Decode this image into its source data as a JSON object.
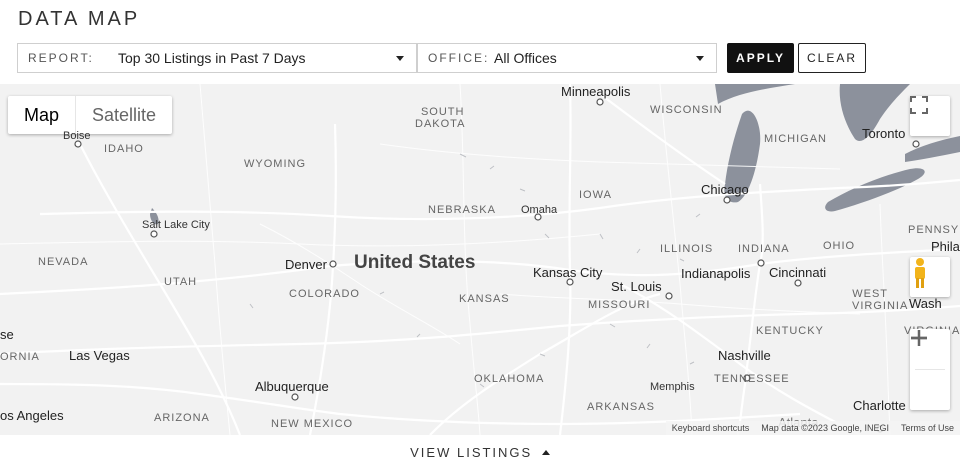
{
  "header": {
    "title": "DATA MAP"
  },
  "filters": {
    "report_label": "REPORT:",
    "report_value": "Top 30 Listings in Past 7 Days",
    "office_label": "OFFICE:",
    "office_value": "All Offices"
  },
  "buttons": {
    "apply": "APPLY",
    "clear": "CLEAR"
  },
  "map": {
    "type_map": "Map",
    "type_satellite": "Satellite",
    "country": "United States",
    "states": {
      "south_dakota_1": "SOUTH",
      "south_dakota_2": "DAKOTA",
      "wisconsin": "WISCONSIN",
      "michigan": "MICHIGAN",
      "idaho": "IDAHO",
      "wyoming": "WYOMING",
      "iowa": "IOWA",
      "nebraska": "NEBRASKA",
      "nevada": "NEVADA",
      "utah": "UTAH",
      "colorado": "COLORADO",
      "kansas": "KANSAS",
      "illinois": "ILLINOIS",
      "indiana": "INDIANA",
      "ohio": "OHIO",
      "pennsylvania": "PENNSYL",
      "missouri": "MISSOURI",
      "west_virginia_1": "WEST",
      "west_virginia_2": "VIRGINIA",
      "kentucky": "KENTUCKY",
      "virginia": "VIRGINIA",
      "tennessee": "TENNESSEE",
      "california": "ORNIA",
      "oklahoma": "OKLAHOMA",
      "arkansas": "ARKANSAS",
      "arizona": "ARIZONA",
      "new_mexico": "NEW MEXICO"
    },
    "cities": {
      "minneapolis": "Minneapolis",
      "toronto": "Toronto",
      "boise": "Boise",
      "chicago": "Chicago",
      "omaha": "Omaha",
      "salt_lake_city": "Salt Lake City",
      "denver": "Denver",
      "kansas_city": "Kansas City",
      "indianapolis": "Indianapolis",
      "cincinnati": "Cincinnati",
      "philadelphia": "Phila",
      "st_louis": "St. Louis",
      "washington": "Wash",
      "las_vegas": "Las Vegas",
      "nashville": "Nashville",
      "albuquerque": "Albuquerque",
      "memphis": "Memphis",
      "charlotte": "Charlotte",
      "los_angeles": "os Angeles",
      "atlanta": "Atlanta",
      "fresno": "se"
    },
    "attribution": {
      "shortcuts": "Keyboard shortcuts",
      "map_data": "Map data ©2023 Google, INEGI",
      "terms": "Terms of Use"
    }
  },
  "footer": {
    "view_listings": "VIEW LISTINGS"
  },
  "colors": {
    "water": "#8c919c",
    "land": "#f2f2f2",
    "road": "#ffffff",
    "accent": "#111111"
  }
}
